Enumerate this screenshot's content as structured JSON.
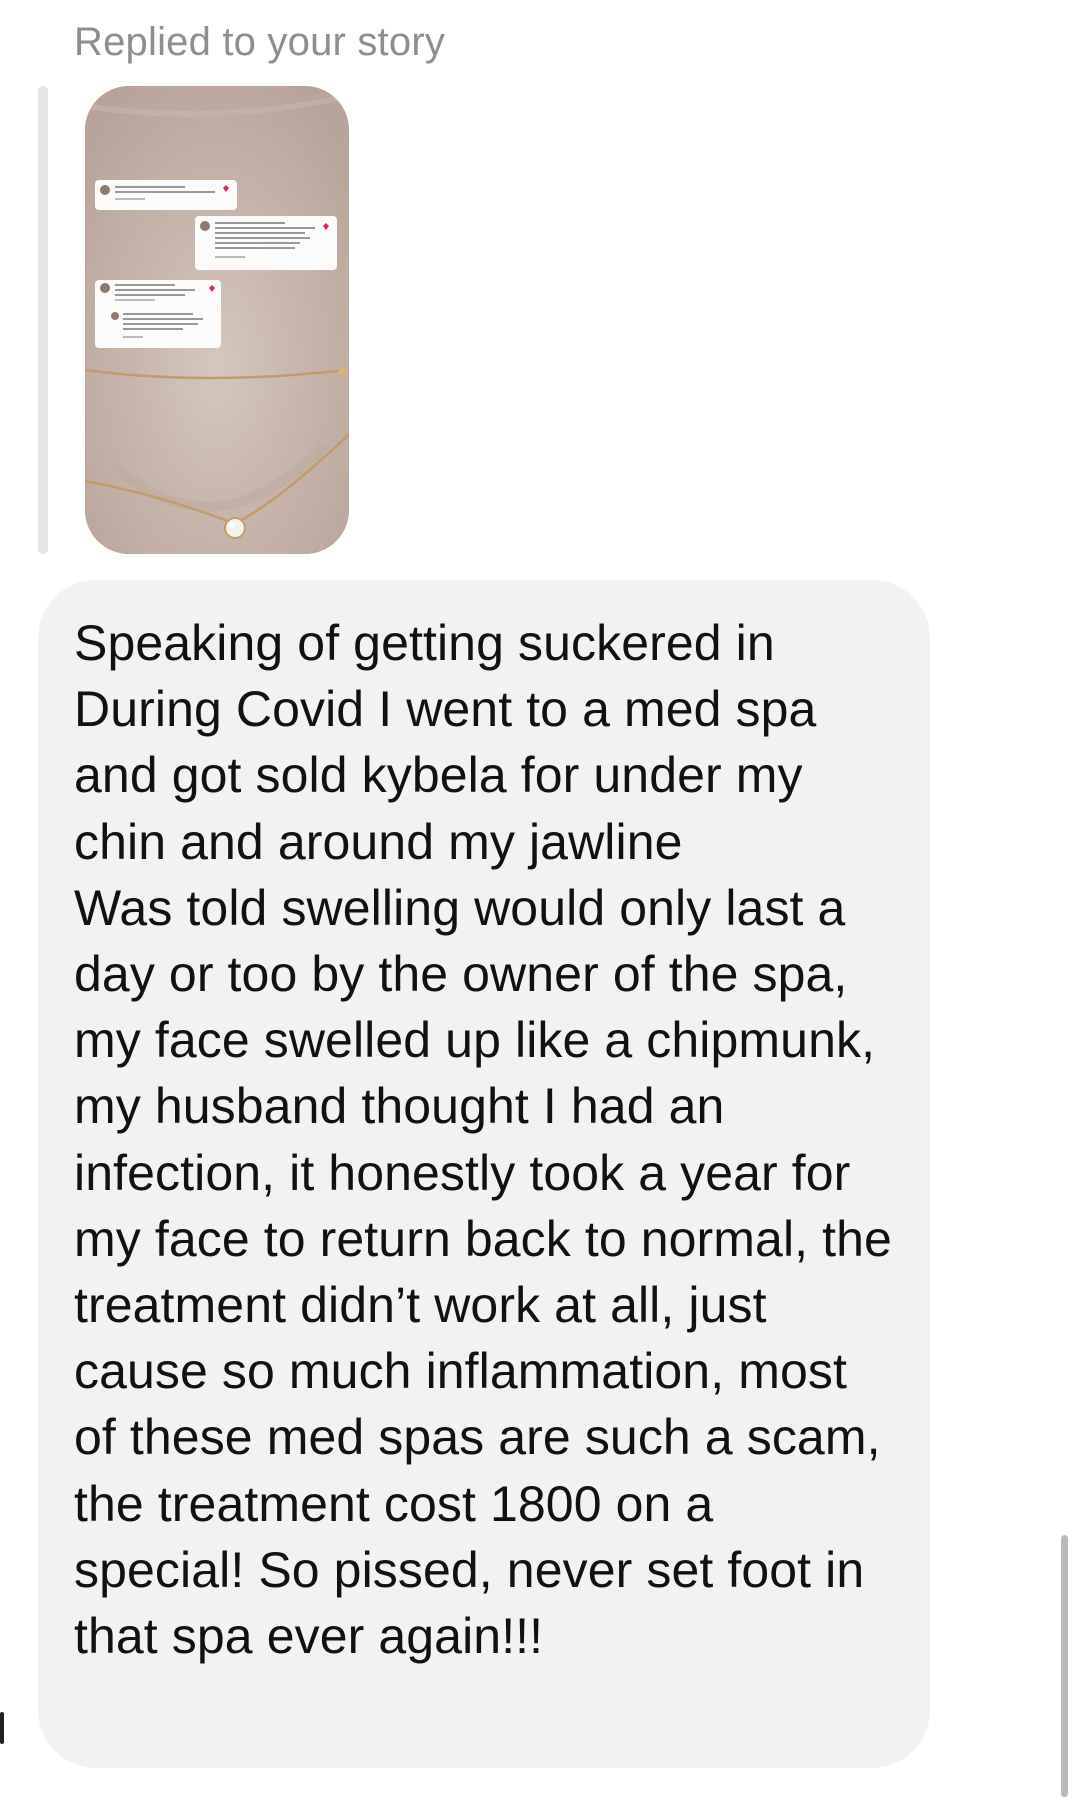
{
  "reply_header": {
    "label": "Replied to your story"
  },
  "story": {
    "icon": "story-thumbnail-image"
  },
  "message": {
    "text": "Speaking of getting suckered in\nDuring Covid I went to a med spa and got sold kybela for under my chin and around my jawline\nWas told swelling would only last a day or too by the owner of the spa, my face swelled up like a chipmunk, my husband thought I had an infection, it honestly took a year for my face to return back to normal, the treatment didn’t work at all, just cause so much inflammation, most of these med spas are such a scam, the treatment cost 1800 on a special! So pissed, never set foot in that spa ever again!!!"
  },
  "colors": {
    "bubble_background": "#f1f2f4",
    "label_gray": "#8e8e8e",
    "heart_red": "#e0245e"
  }
}
